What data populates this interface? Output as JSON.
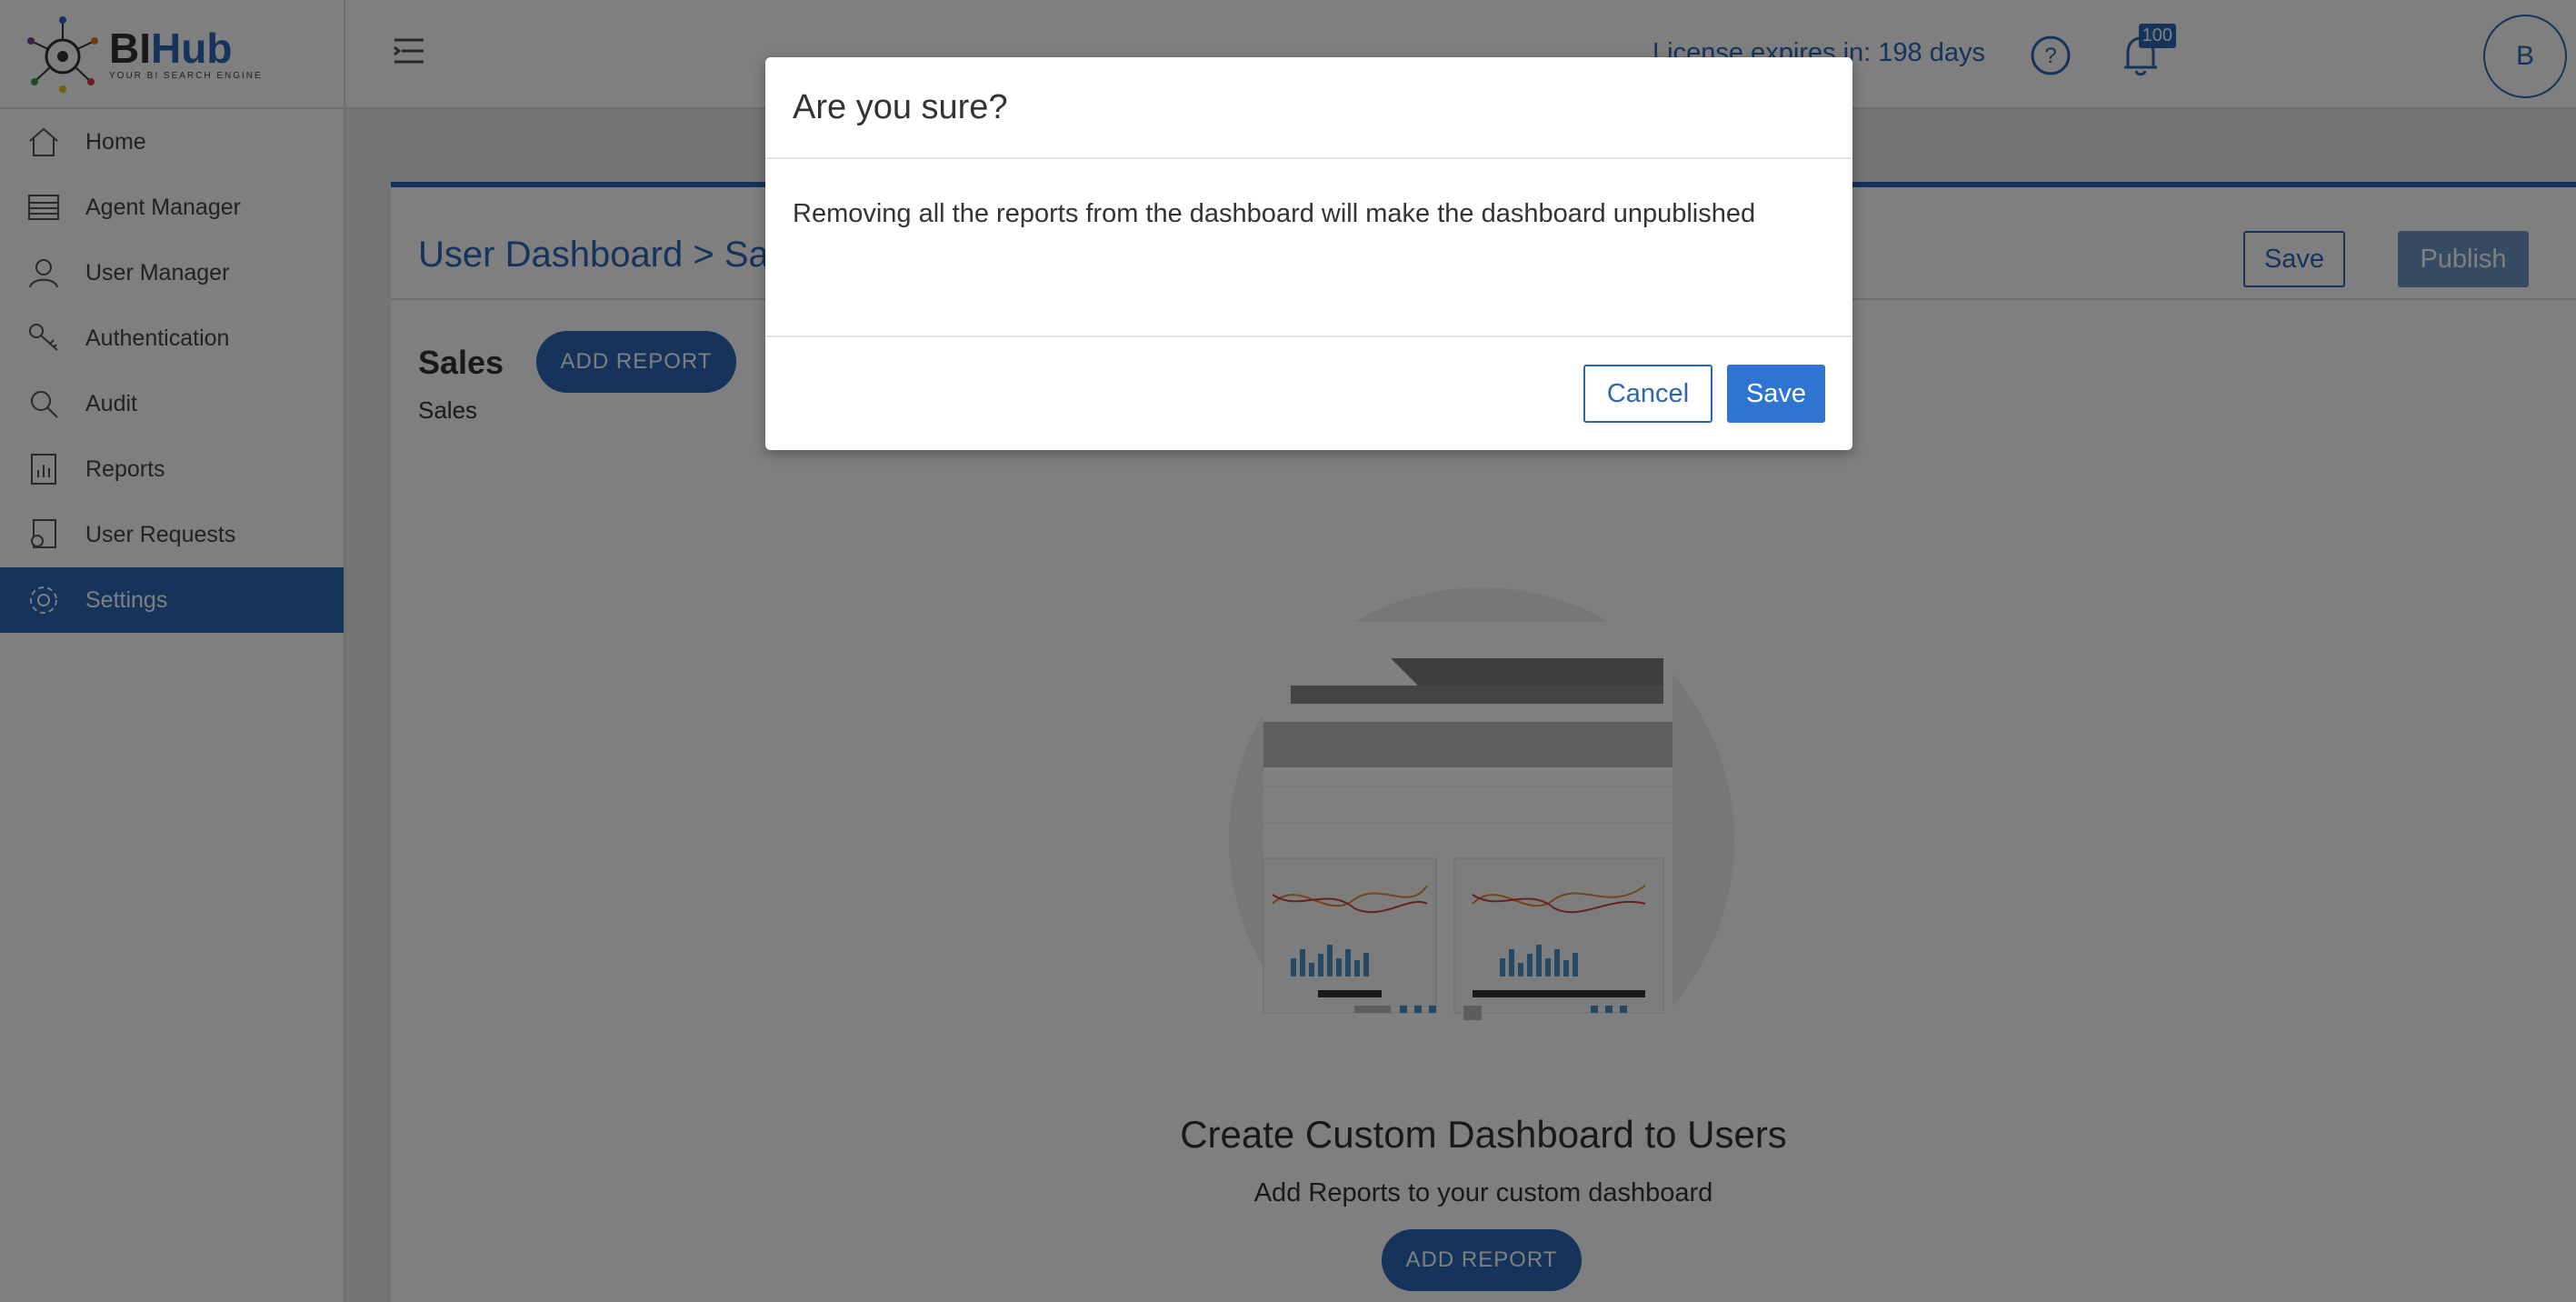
{
  "app": {
    "logo_title_bi": "BI",
    "logo_title_hub": "Hub",
    "logo_tagline": "YOUR BI SEARCH ENGINE"
  },
  "sidebar": {
    "items": [
      {
        "label": "Home",
        "icon": "home-icon"
      },
      {
        "label": "Agent Manager",
        "icon": "server-icon"
      },
      {
        "label": "User Manager",
        "icon": "user-icon"
      },
      {
        "label": "Authentication",
        "icon": "key-icon"
      },
      {
        "label": "Audit",
        "icon": "audit-search-icon"
      },
      {
        "label": "Reports",
        "icon": "reports-icon"
      },
      {
        "label": "User Requests",
        "icon": "user-requests-icon"
      },
      {
        "label": "Settings",
        "icon": "gear-icon",
        "active": true
      }
    ]
  },
  "header": {
    "license_text": "License expires in: 198 days",
    "notification_count": "100",
    "avatar_initial": "B"
  },
  "main": {
    "breadcrumb": "User Dashboard > Sales",
    "save_label": "Save",
    "publish_label": "Publish",
    "section_title": "Sales",
    "section_subtitle": "Sales",
    "add_report_label": "ADD REPORT",
    "empty_title": "Create Custom Dashboard to Users",
    "empty_subtitle": "Add Reports to your custom dashboard",
    "empty_add_report_label": "ADD REPORT"
  },
  "modal": {
    "title": "Are you sure?",
    "message": "Removing all the reports from the dashboard will make the dashboard unpublished",
    "cancel_label": "Cancel",
    "save_label": "Save"
  },
  "colors": {
    "accent": "#2b66b6",
    "overlay": "rgba(0,0,0,0.5)"
  }
}
